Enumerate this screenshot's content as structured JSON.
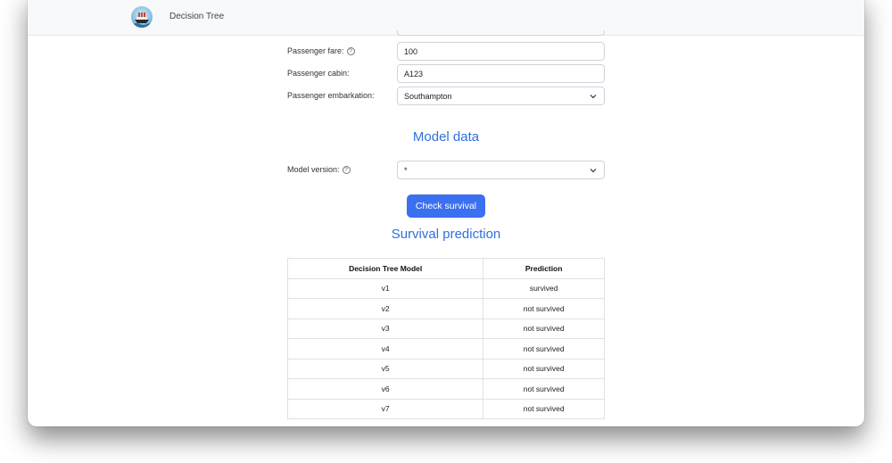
{
  "navbar": {
    "brand": "Decision Tree",
    "logo_icon": "titanic-ship-icon"
  },
  "passenger": {
    "fare_label": "Passenger fare:",
    "fare_value": "100",
    "cabin_label": "Passenger cabin:",
    "cabin_value": "A123",
    "embarkation_label": "Passenger embarkation:",
    "embarkation_value": "Southampton"
  },
  "model": {
    "heading": "Model data",
    "version_label": "Model version:",
    "version_value": "*"
  },
  "actions": {
    "check_label": "Check survival"
  },
  "prediction": {
    "heading": "Survival prediction",
    "columns": [
      "Decision Tree Model",
      "Prediction"
    ],
    "rows": [
      [
        "v1",
        "survived"
      ],
      [
        "v2",
        "not survived"
      ],
      [
        "v3",
        "not survived"
      ],
      [
        "v4",
        "not survived"
      ],
      [
        "v5",
        "not survived"
      ],
      [
        "v6",
        "not survived"
      ],
      [
        "v7",
        "not survived"
      ]
    ]
  },
  "colors": {
    "accent": "#3b70f0",
    "heading": "#2f6fe0",
    "navbar_bg": "#f8f9fa"
  }
}
